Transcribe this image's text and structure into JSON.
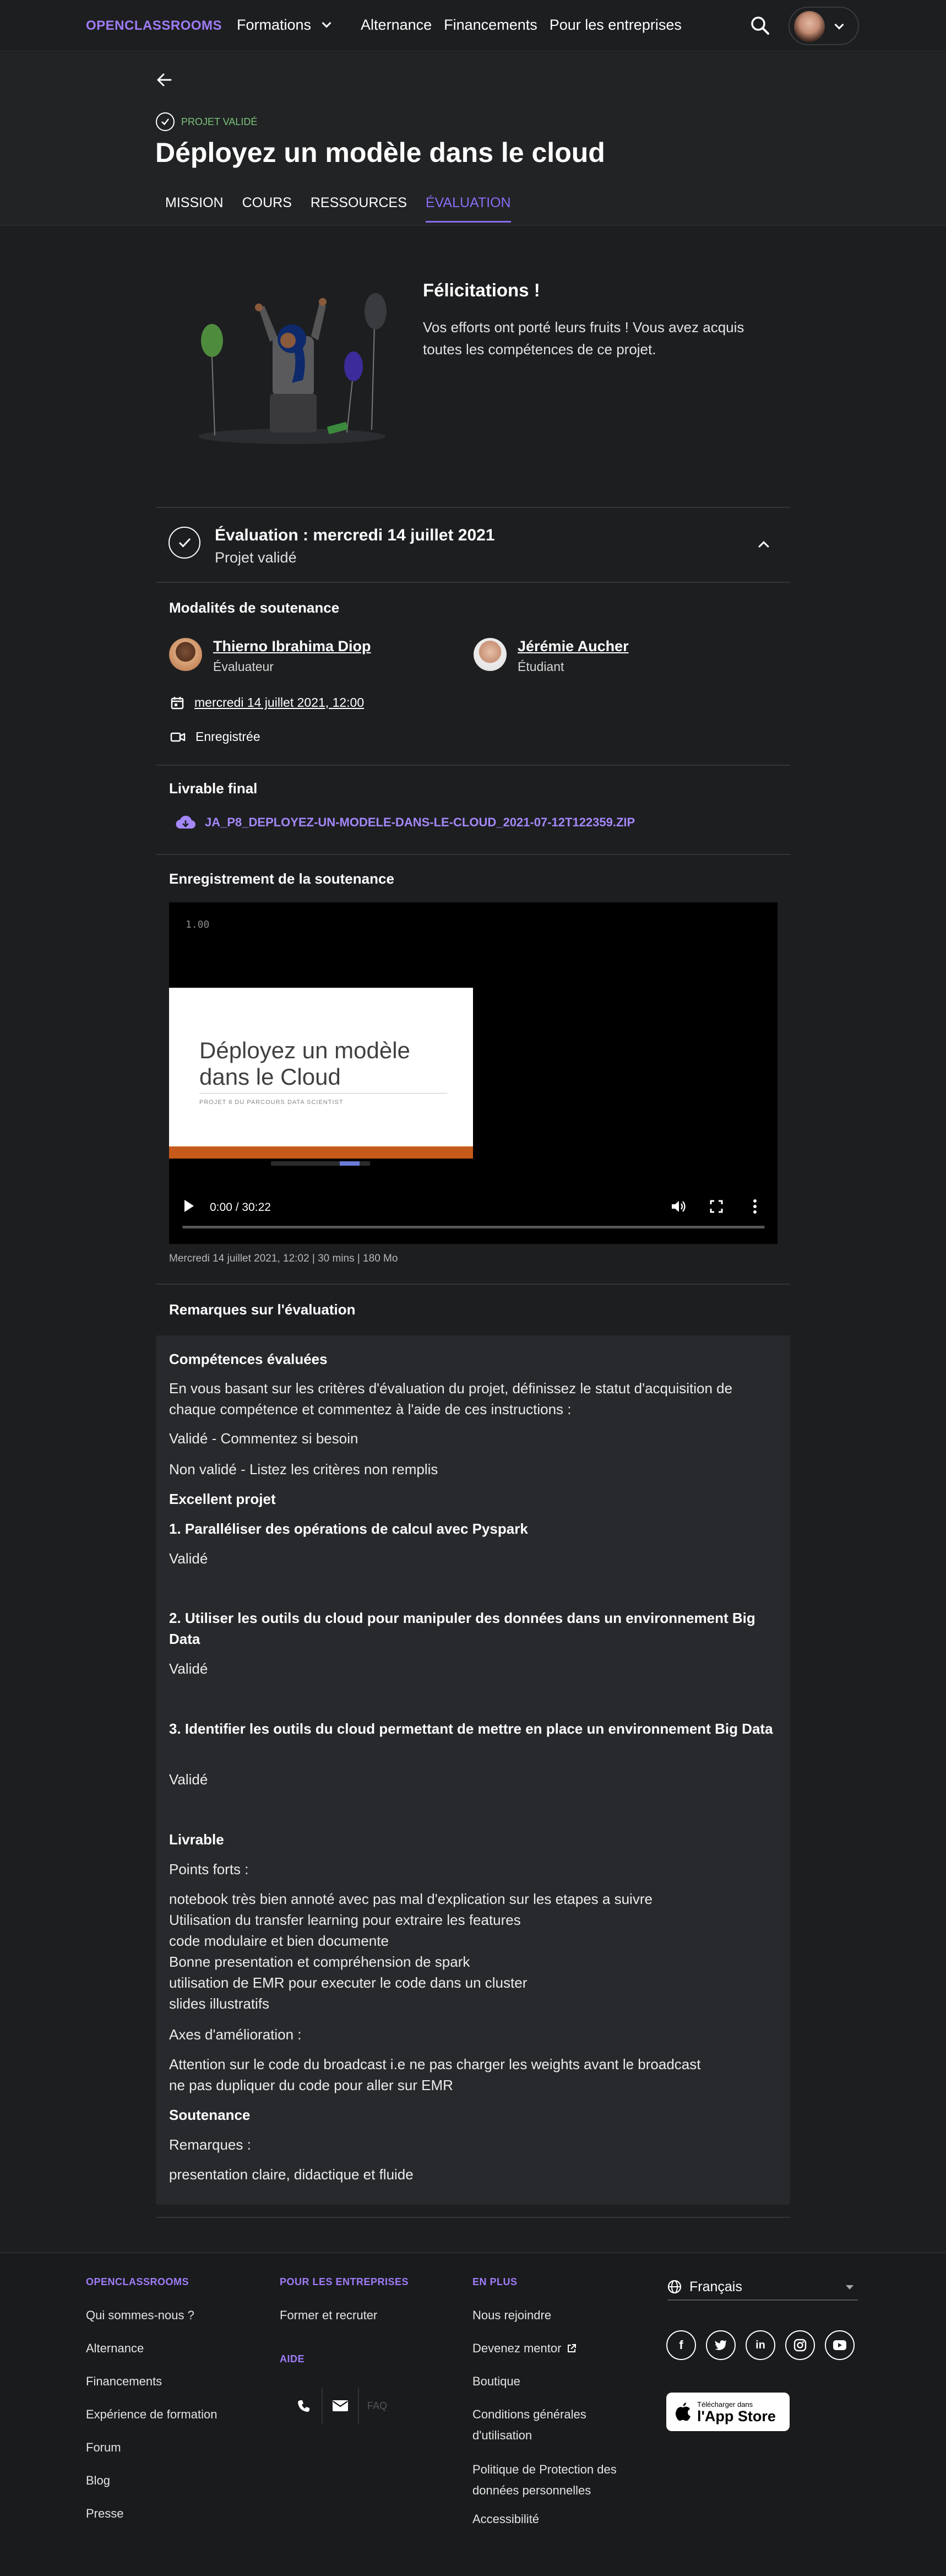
{
  "header": {
    "logo": "OPENCLASSROOMS",
    "nav": [
      "Formations",
      "Alternance",
      "Financements",
      "Pour les entreprises"
    ]
  },
  "project": {
    "status": "PROJET VALIDÉ",
    "title": "Déployez un modèle dans le cloud",
    "tabs": [
      "MISSION",
      "COURS",
      "RESSOURCES",
      "ÉVALUATION"
    ],
    "active_tab": "ÉVALUATION"
  },
  "congrats": {
    "title": "Félicitations !",
    "text": "Vos efforts ont porté leurs fruits ! Vous avez acquis toutes les compétences de ce projet."
  },
  "evaluation": {
    "title": "Évaluation : mercredi 14 juillet 2021",
    "subtitle": "Projet validé",
    "modalites_title": "Modalités de soutenance",
    "evaluator": {
      "name": "Thierno Ibrahima Diop",
      "role": "Évaluateur"
    },
    "student": {
      "name": "Jérémie Aucher",
      "role": "Étudiant"
    },
    "date": "mercredi 14 juillet 2021, 12:00",
    "recording_status": "Enregistrée",
    "deliverable_title": "Livrable final",
    "deliverable_file": "JA_P8_DEPLOYEZ-UN-MODELE-DANS-LE-CLOUD_2021-07-12T122359.ZIP",
    "recording_title": "Enregistrement de la soutenance",
    "video": {
      "corner_label": "1.00",
      "slide_title": "Déployez un modèle dans le Cloud",
      "slide_subtitle": "PROJET 8 DU PARCOURS DATA SCIENTIST",
      "time": "0:00 / 30:22",
      "progress": 0
    },
    "video_caption": "Mercredi 14 juillet 2021, 12:02 | 30 mins | 180 Mo",
    "remarks_title": "Remarques sur l'évaluation"
  },
  "remarks": {
    "competences_title": "Compétences évaluées",
    "intro": "En vous basant sur les critères d'évaluation du projet, définissez le statut d'acquisition de chaque compétence et commentez à l'aide de ces instructions :",
    "line_valide": "Validé - Commentez si besoin",
    "line_non_valide": "Non validé - Listez les critères non remplis",
    "excellent": "Excellent projet",
    "c1": "1. Paralléliser des opérations de calcul avec Pyspark",
    "c1_status": "Validé",
    "c2": "2. Utiliser les outils du cloud pour manipuler des données dans un environnement Big Data",
    "c2_status": "Validé",
    "c3": "3. Identifier les outils du cloud permettant de mettre en place un environnement Big Data",
    "c3_status": "Validé",
    "livrable": "Livrable",
    "points_forts": "Points forts :",
    "pf1": "notebook très bien annoté avec pas mal d'explication sur les etapes a suivre",
    "pf2": "Utilisation du transfer learning pour extraire les features",
    "pf3": "code modulaire et bien documente",
    "pf4": "Bonne presentation et compréhension de spark",
    "pf5": "utilisation de EMR pour executer le code dans un cluster",
    "pf6": "slides illustratifs",
    "axes": "Axes d'amélioration :",
    "ax1": "Attention sur le code du broadcast i.e ne pas charger les weights avant le broadcast",
    "ax2": "ne pas dupliquer du code pour aller sur EMR",
    "soutenance": "Soutenance",
    "remarques": "Remarques :",
    "rem1": "presentation claire, didactique et fluide"
  },
  "footer": {
    "col1_title": "OPENCLASSROOMS",
    "col1": [
      "Qui sommes-nous ?",
      "Alternance",
      "Financements",
      "Expérience de formation",
      "Forum",
      "Blog",
      "Presse"
    ],
    "col2_title": "POUR LES ENTREPRISES",
    "col2": [
      "Former et recruter"
    ],
    "aide_title": "AIDE",
    "faq": "FAQ",
    "col3_title": "EN PLUS",
    "col3": [
      "Nous rejoindre",
      "Devenez mentor",
      "Boutique",
      "Conditions générales d'utilisation",
      "Politique de Protection des données personnelles",
      "Accessibilité"
    ],
    "language": "Français",
    "appstore_small": "Télécharger dans",
    "appstore_big": "l'App Store"
  }
}
